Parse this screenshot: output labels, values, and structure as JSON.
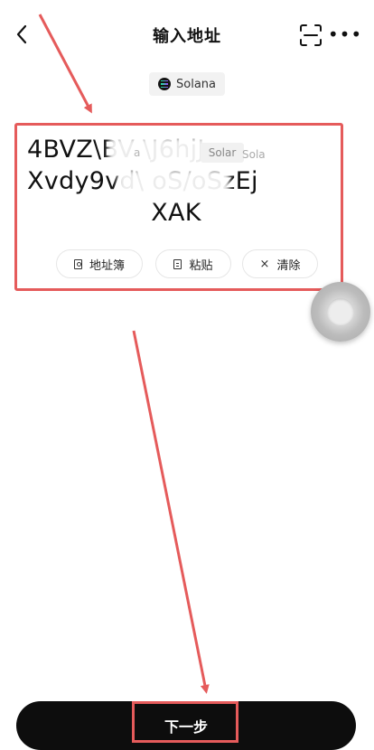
{
  "header": {
    "title": "输入地址",
    "back_icon": "chevron-left-icon",
    "scan_icon": "scan-icon",
    "more_label": "•••"
  },
  "network": {
    "label": "Solana",
    "icon": "solana-logo-icon"
  },
  "address": {
    "line1": "4BVZ\\BV          \\J6hjJ",
    "line2": "Xvdy9vd\\        oS/oSzEj",
    "line3": "XAK"
  },
  "watermarks": {
    "w1": "a",
    "w2": "Solar",
    "w3": "Sola"
  },
  "actions": {
    "address_book": "地址簿",
    "paste": "粘贴",
    "clear": "清除"
  },
  "footer": {
    "next_label": "下一步"
  },
  "colors": {
    "highlight": "#e55b5b",
    "primary_button": "#0d0d0d"
  }
}
